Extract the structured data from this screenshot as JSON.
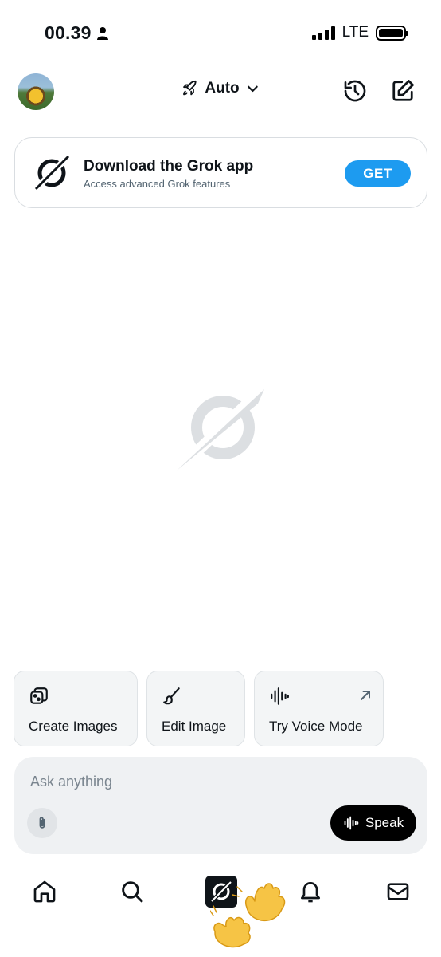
{
  "status_bar": {
    "time": "00.39",
    "network": "LTE",
    "signal_bars": 4,
    "battery_level": 1.0
  },
  "header": {
    "model_label": "Auto",
    "icons": [
      "rocket-icon",
      "chevron-down-icon",
      "history-icon",
      "new-chat-icon"
    ]
  },
  "banner": {
    "title": "Download the Grok app",
    "subtitle": "Access advanced Grok features",
    "button_label": "GET"
  },
  "suggestions": [
    {
      "label": "Create Images",
      "icon": "dice-image-icon"
    },
    {
      "label": "Edit Image",
      "icon": "brush-icon"
    },
    {
      "label": "Try Voice Mode",
      "icon": "waveform-icon",
      "trailing_icon": "arrow-up-right-icon"
    }
  ],
  "composer": {
    "placeholder": "Ask anything",
    "value": "",
    "speak_label": "Speak"
  },
  "bottom_nav": {
    "items": [
      "home-icon",
      "search-icon",
      "grok-icon",
      "notifications-icon",
      "messages-icon"
    ],
    "active": "grok-icon"
  },
  "colors": {
    "accent": "#1d9bf0",
    "text": "#0f1419",
    "muted": "#536471",
    "chip_bg": "#f3f5f6",
    "composer_bg": "#eff1f3",
    "logo_watermark": "#dcdfe2"
  }
}
